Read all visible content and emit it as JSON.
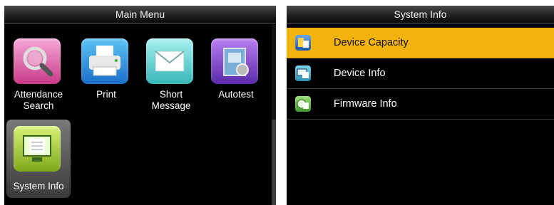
{
  "main_menu": {
    "title": "Main Menu",
    "items": [
      {
        "label": "Attendance\nSearch",
        "icon": "magnifier-icon"
      },
      {
        "label": "Print",
        "icon": "printer-icon"
      },
      {
        "label": "Short\nMessage",
        "icon": "envelope-icon"
      },
      {
        "label": "Autotest",
        "icon": "autotest-icon"
      },
      {
        "label": "System Info",
        "icon": "system-info-icon"
      }
    ],
    "selected": "System Info"
  },
  "system_info": {
    "title": "System Info",
    "items": [
      {
        "label": "Device Capacity",
        "icon": "device-capacity-icon"
      },
      {
        "label": "Device Info",
        "icon": "device-info-icon"
      },
      {
        "label": "Firmware Info",
        "icon": "firmware-info-icon"
      }
    ],
    "selected": "Device Capacity"
  },
  "colors": {
    "selection": "#f3b30f",
    "background": "#000000"
  }
}
